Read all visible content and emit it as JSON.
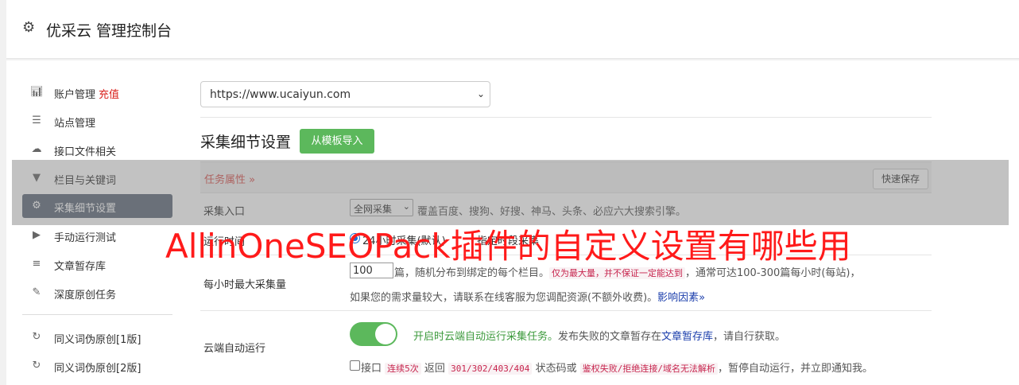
{
  "header": {
    "title": "优采云 管理控制台",
    "icon": "gear-icon"
  },
  "sidebar": {
    "items": [
      {
        "label": "账户管理",
        "badge": "充值",
        "icon": "bar-chart-icon"
      },
      {
        "label": "站点管理",
        "icon": "server-icon"
      },
      {
        "label": "接口文件相关",
        "icon": "cloud-upload-icon"
      },
      {
        "label": "栏目与关键词",
        "icon": "filter-icon"
      },
      {
        "label": "采集细节设置",
        "icon": "cogs-icon",
        "active": true
      },
      {
        "label": "手动运行测试",
        "icon": "play-circle-icon"
      },
      {
        "label": "文章暂存库",
        "icon": "database-icon"
      },
      {
        "label": "深度原创任务",
        "icon": "edit-icon"
      },
      {
        "label": "同义词伪原创[1版]",
        "icon": "refresh-icon"
      },
      {
        "label": "同义词伪原创[2版]",
        "icon": "refresh-icon"
      }
    ]
  },
  "site_select": {
    "value": "https://www.ucaiyun.com"
  },
  "section": {
    "title": "采集细节设置",
    "import_button": "从模板导入"
  },
  "tabbar": {
    "tab_label": "任务属性 »",
    "save_button": "快速保存"
  },
  "rows": {
    "entry": {
      "label": "采集入口",
      "select_value": "全网采集",
      "desc": "覆盖百度、搜狗、好搜、神马、头条、必应六大搜索引擎。"
    },
    "runtime": {
      "label": "运行时间",
      "radio_text": "24小时采集(默认)",
      "extra": "指定时段采集"
    },
    "max_per_hour": {
      "label": "每小时最大采集量",
      "value": "100",
      "text1": "篇，随机分布到绑定的每个栏目。",
      "note": "仅为最大量，并不保证一定能达到",
      "text2": "，通常可达100-300篇每小时(每站)，",
      "text3": "如果您的需求量较大，请联系在线客服为您调配资源(不额外收费)。",
      "link": "影响因素"
    },
    "cloud_run": {
      "label": "云端自动运行",
      "toggle_on": true,
      "green_text": "开启时云端自动运行采集任务。",
      "text1": "发布失败的文章暂存在",
      "link": "文章暂存库",
      "text2": "，请自行获取。",
      "check_prefix": "接口",
      "code1": "连续5次",
      "text3": "返回",
      "code2": "301/302/403/404",
      "text4": "状态码或",
      "code3": "鉴权失败/拒绝连接/域名无法解析",
      "text5": "，暂停自动运行，并立即通知我。"
    }
  },
  "watermark": "AllinOneSEOPack插件的自定义设置有哪些用"
}
